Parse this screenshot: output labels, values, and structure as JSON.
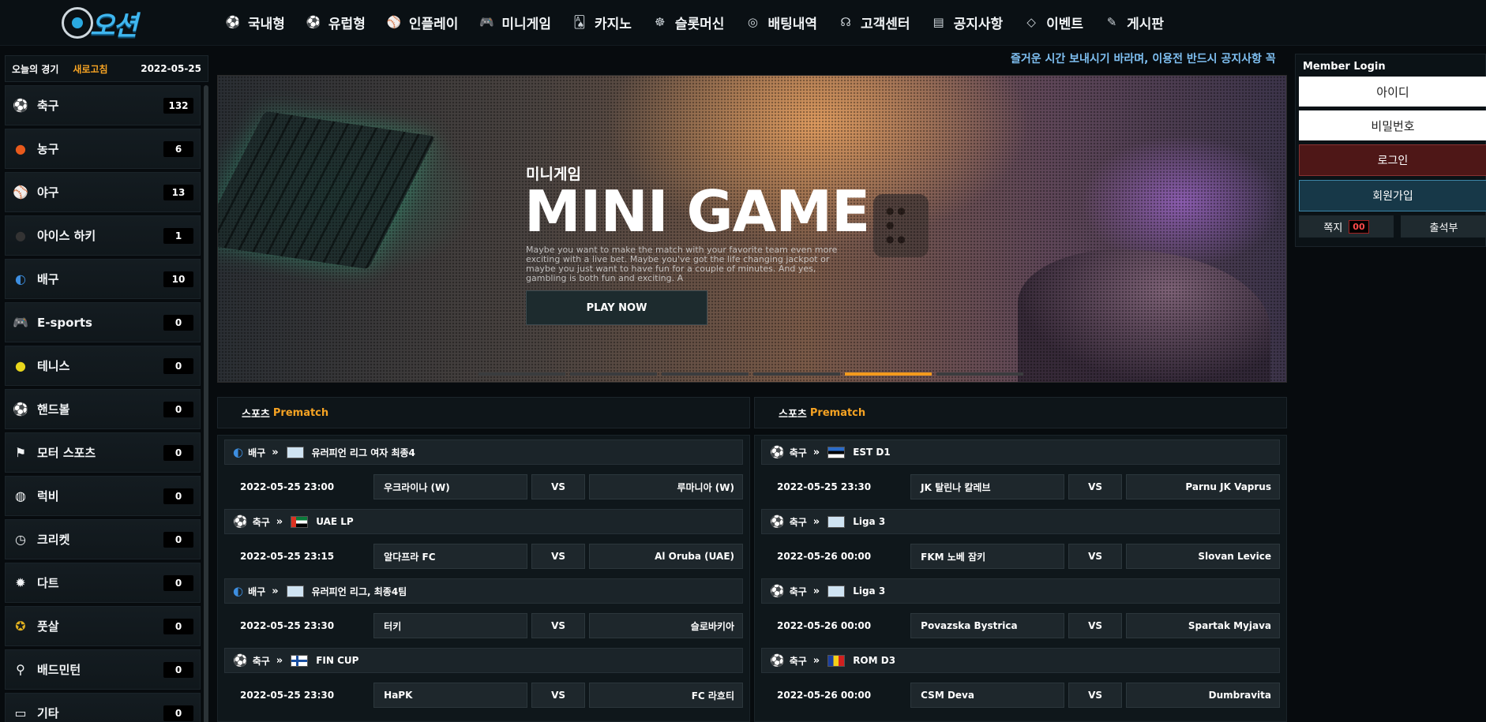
{
  "header": {
    "logo_text": "오션",
    "nav": [
      {
        "label": "국내형",
        "icon": "soccer-ball-icon"
      },
      {
        "label": "유럽형",
        "icon": "soccer-ball-icon"
      },
      {
        "label": "인플레이",
        "icon": "baseball-icon"
      },
      {
        "label": "미니게임",
        "icon": "gamepad-icon"
      },
      {
        "label": "카지노",
        "icon": "cards-icon"
      },
      {
        "label": "슬롯머신",
        "icon": "slot-wheel-icon"
      },
      {
        "label": "배팅내역",
        "icon": "target-icon"
      },
      {
        "label": "고객센터",
        "icon": "headset-icon"
      },
      {
        "label": "공지사항",
        "icon": "clipboard-icon"
      },
      {
        "label": "이벤트",
        "icon": "diamond-icon"
      },
      {
        "label": "게시판",
        "icon": "edit-icon"
      }
    ]
  },
  "sidebar": {
    "title": "오늘의 경기",
    "refresh": "새로고침",
    "date": "2022-05-25",
    "items": [
      {
        "label": "축구",
        "count": "132",
        "icon": "soccer-ball-icon"
      },
      {
        "label": "농구",
        "count": "6",
        "icon": "basketball-icon"
      },
      {
        "label": "야구",
        "count": "13",
        "icon": "baseball-icon"
      },
      {
        "label": "아이스 하키",
        "count": "1",
        "icon": "hockey-puck-icon"
      },
      {
        "label": "배구",
        "count": "10",
        "icon": "volleyball-icon"
      },
      {
        "label": "E-sports",
        "count": "0",
        "icon": "gamepad-icon"
      },
      {
        "label": "테니스",
        "count": "0",
        "icon": "tennis-ball-icon"
      },
      {
        "label": "핸드볼",
        "count": "0",
        "icon": "handball-icon"
      },
      {
        "label": "모터 스포츠",
        "count": "0",
        "icon": "checkered-flag-icon"
      },
      {
        "label": "럭비",
        "count": "0",
        "icon": "rugby-ball-icon"
      },
      {
        "label": "크리켓",
        "count": "0",
        "icon": "cricket-icon"
      },
      {
        "label": "다트",
        "count": "0",
        "icon": "dart-icon"
      },
      {
        "label": "풋살",
        "count": "0",
        "icon": "futsal-ball-icon"
      },
      {
        "label": "배드민턴",
        "count": "0",
        "icon": "badminton-icon"
      },
      {
        "label": "기타",
        "count": "0",
        "icon": "other-icon"
      }
    ]
  },
  "marquee": "즐거운 시간 보내시기 바라며, 이용전 반드시 공지사항 꼭",
  "banner": {
    "title_kr": "미니게임",
    "title": "MINI GAME",
    "desc": "Maybe you want to make the match with your favorite team even more exciting with a live bet. Maybe you've got the life changing jackpot or maybe you just want to have fun for a couple of minutes. And yes, gambling is both fun and exciting. A",
    "button": "PLAY NOW",
    "slides": 6,
    "active_slide": 5
  },
  "login": {
    "title": "Member Login",
    "id_placeholder": "아이디",
    "pw_placeholder": "비밀번호",
    "login_btn": "로그인",
    "join_btn": "회원가입",
    "message_label": "쪽지",
    "message_count": "00",
    "attendance": "출석부"
  },
  "panels": [
    {
      "head": "스포츠",
      "accent": "Prematch",
      "matches": [
        {
          "sport": "배구",
          "sport_icon": "volleyball-icon",
          "flag": "eu",
          "league": "유러피언 리그 여자 최종4",
          "time": "2022-05-25 23:00",
          "home": "우크라이나 (W)",
          "vs": "VS",
          "away": "루마니아 (W)"
        },
        {
          "sport": "축구",
          "sport_icon": "soccer-ball-icon",
          "flag": "uae",
          "league": "UAE LP",
          "time": "2022-05-25 23:15",
          "home": "알다프라 FC",
          "vs": "VS",
          "away": "Al Oruba (UAE)"
        },
        {
          "sport": "배구",
          "sport_icon": "volleyball-icon",
          "flag": "eu",
          "league": "유러피언 리그, 최종4팀",
          "time": "2022-05-25 23:30",
          "home": "터키",
          "vs": "VS",
          "away": "슬로바키아"
        },
        {
          "sport": "축구",
          "sport_icon": "soccer-ball-icon",
          "flag": "finland",
          "league": "FIN CUP",
          "time": "2022-05-25 23:30",
          "home": "HaPK",
          "vs": "VS",
          "away": "FC 라흐티"
        }
      ]
    },
    {
      "head": "스포츠",
      "accent": "Prematch",
      "matches": [
        {
          "sport": "축구",
          "sport_icon": "soccer-ball-icon",
          "flag": "estonia",
          "league": "EST D1",
          "time": "2022-05-25 23:30",
          "home": "JK 탈린나 칼레브",
          "vs": "VS",
          "away": "Parnu JK Vaprus"
        },
        {
          "sport": "축구",
          "sport_icon": "soccer-ball-icon",
          "flag": "eu",
          "league": "Liga 3",
          "time": "2022-05-26 00:00",
          "home": "FKM 노베 잠키",
          "vs": "VS",
          "away": "Slovan Levice"
        },
        {
          "sport": "축구",
          "sport_icon": "soccer-ball-icon",
          "flag": "eu",
          "league": "Liga 3",
          "time": "2022-05-26 00:00",
          "home": "Povazska Bystrica",
          "vs": "VS",
          "away": "Spartak Myjava"
        },
        {
          "sport": "축구",
          "sport_icon": "soccer-ball-icon",
          "flag": "romania",
          "league": "ROM D3",
          "time": "2022-05-26 00:00",
          "home": "CSM Deva",
          "vs": "VS",
          "away": "Dumbravita"
        }
      ]
    }
  ],
  "colors": {
    "accent": "#f6a323",
    "login_red": "#4e1717",
    "join_blue": "#173848",
    "marquee": "#7fc0f2"
  }
}
